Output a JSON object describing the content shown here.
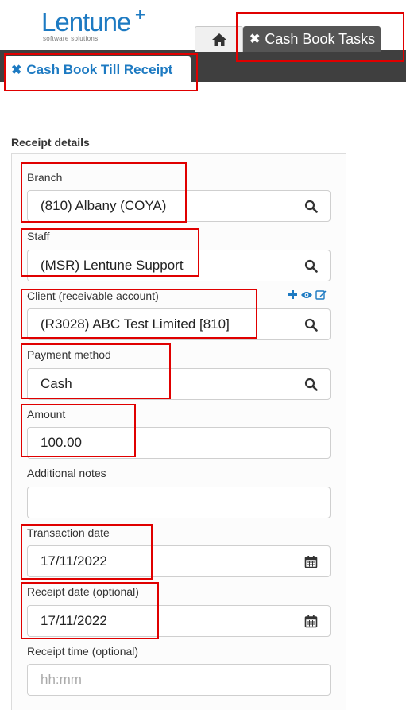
{
  "header": {
    "logo_text": "Lentune",
    "logo_plus": "+",
    "logo_subtitle": "software solutions"
  },
  "tabs": {
    "home_icon": "home-icon",
    "tasks_label": "Cash Book Tasks",
    "receipt_label": "Cash Book Till Receipt",
    "close_icon": "✖"
  },
  "form": {
    "section_title": "Receipt details",
    "branch": {
      "label": "Branch",
      "value": "(810) Albany (COYA)",
      "icon": "search-icon"
    },
    "staff": {
      "label": "Staff",
      "value": "(MSR) Lentune Support",
      "icon": "search-icon"
    },
    "client": {
      "label": "Client (receivable account)",
      "value": "(R3028) ABC Test Limited [810]",
      "icon": "search-icon",
      "action_icons": [
        "plus-icon",
        "eye-icon",
        "edit-icon"
      ]
    },
    "payment_method": {
      "label": "Payment method",
      "value": "Cash",
      "icon": "search-icon"
    },
    "amount": {
      "label": "Amount",
      "value": "100.00"
    },
    "notes": {
      "label": "Additional notes",
      "value": ""
    },
    "transaction_date": {
      "label": "Transaction date",
      "value": "17/11/2022",
      "icon": "calendar-icon"
    },
    "receipt_date": {
      "label": "Receipt date (optional)",
      "value": "17/11/2022",
      "icon": "calendar-icon"
    },
    "receipt_time": {
      "label": "Receipt time (optional)",
      "placeholder": "hh:mm"
    }
  },
  "colors": {
    "brand_blue": "#1d7ac2",
    "tabstrip": "#3f3f3f",
    "highlight": "#e00000"
  }
}
